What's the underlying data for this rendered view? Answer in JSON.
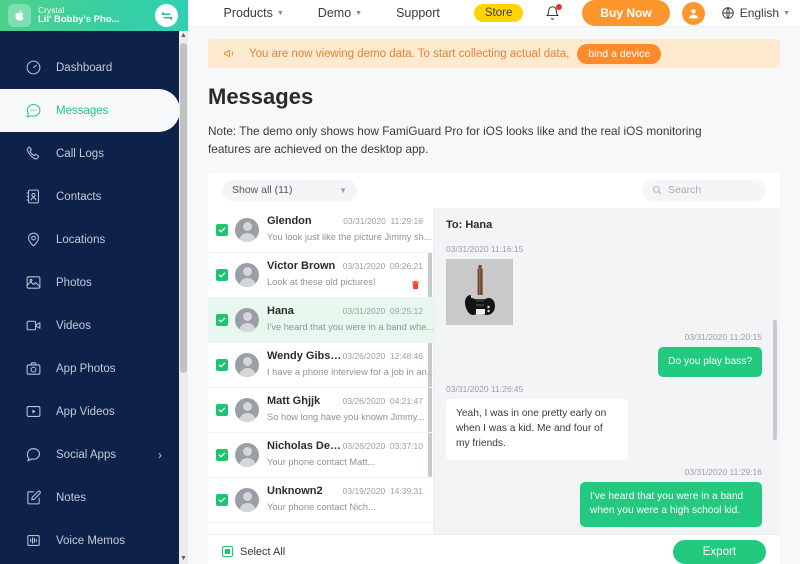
{
  "device": {
    "os_icon": "apple-icon",
    "owner": "Crystal",
    "phone_name": "Lil' Bobby's Pho...",
    "switch_icon": "switch-device-icon"
  },
  "sidebar": {
    "items": [
      {
        "label": "Dashboard",
        "icon": "dashboard-icon",
        "active": false,
        "chevron": false
      },
      {
        "label": "Messages",
        "icon": "messages-icon",
        "active": true,
        "chevron": false
      },
      {
        "label": "Call Logs",
        "icon": "phone-icon",
        "active": false,
        "chevron": false
      },
      {
        "label": "Contacts",
        "icon": "contacts-icon",
        "active": false,
        "chevron": false
      },
      {
        "label": "Locations",
        "icon": "location-pin-icon",
        "active": false,
        "chevron": false
      },
      {
        "label": "Photos",
        "icon": "photo-icon",
        "active": false,
        "chevron": false
      },
      {
        "label": "Videos",
        "icon": "video-icon",
        "active": false,
        "chevron": false
      },
      {
        "label": "App Photos",
        "icon": "camera-icon",
        "active": false,
        "chevron": false
      },
      {
        "label": "App Videos",
        "icon": "play-box-icon",
        "active": false,
        "chevron": false
      },
      {
        "label": "Social Apps",
        "icon": "chat-bubble-icon",
        "active": false,
        "chevron": true
      },
      {
        "label": "Notes",
        "icon": "note-edit-icon",
        "active": false,
        "chevron": false
      },
      {
        "label": "Voice Memos",
        "icon": "waveform-icon",
        "active": false,
        "chevron": false
      }
    ]
  },
  "topnav": {
    "links": [
      {
        "label": "Products",
        "caret": true
      },
      {
        "label": "Demo",
        "caret": true
      },
      {
        "label": "Support",
        "caret": false
      }
    ],
    "store_label": "Store",
    "bell_icon": "notification-bell-icon",
    "buy_now_label": "Buy Now",
    "account_icon": "user-avatar-icon",
    "language_label": "English",
    "language_icon": "globe-icon"
  },
  "banner": {
    "icon": "megaphone-icon",
    "text": "You are now viewing demo data. To start collecting actual data,",
    "button_label": "bind a device"
  },
  "page": {
    "title": "Messages",
    "note": "Note: The demo only shows how FamiGuard Pro for iOS looks like and the real iOS monitoring features are achieved on the desktop app."
  },
  "toolbar": {
    "filter_label": "Show all (11)",
    "filter_caret_icon": "chevron-down-icon",
    "search_icon": "search-icon",
    "search_placeholder": "Search",
    "search_value": ""
  },
  "conversations": [
    {
      "name": "Glendon",
      "date": "03/31/2020",
      "time": "11:29:16",
      "preview": "You look just like the picture Jimmy sh...",
      "checked": true,
      "selected": false,
      "delete": false
    },
    {
      "name": "Victor Brown",
      "date": "03/31/2020",
      "time": "09:26:21",
      "preview": "Look at these old pictures!",
      "checked": true,
      "selected": false,
      "delete": true
    },
    {
      "name": "Hana",
      "date": "03/31/2020",
      "time": "09:25:12",
      "preview": "I've heard that you were in a band whe...",
      "checked": true,
      "selected": true,
      "delete": false
    },
    {
      "name": "Wendy Gibson",
      "date": "03/26/2020",
      "time": "12:48:46",
      "preview": "I have a phone interview for a job in an...",
      "checked": true,
      "selected": false,
      "delete": false
    },
    {
      "name": "Matt Ghjjk",
      "date": "03/26/2020",
      "time": "04:21:47",
      "preview": "So how long have you known Jimmy...",
      "checked": true,
      "selected": false,
      "delete": false
    },
    {
      "name": "Nicholas Dell...",
      "date": "03/26/2020",
      "time": "03:37:10",
      "preview": "Your phone contact Matt...",
      "checked": true,
      "selected": false,
      "delete": false
    },
    {
      "name": "Unknown2",
      "date": "03/19/2020",
      "time": "14:39:31",
      "preview": "Your phone contact Nich...",
      "checked": true,
      "selected": false,
      "delete": false
    }
  ],
  "chat": {
    "to_label": "To: Hana",
    "messages": [
      {
        "direction": "in",
        "timestamp": "03/31/2020  11:16:15",
        "type": "image",
        "text": "",
        "image_icon": "bass-guitar-photo"
      },
      {
        "direction": "out",
        "timestamp": "03/31/2020  11:20:15",
        "type": "text",
        "text": "Do you play bass?"
      },
      {
        "direction": "in",
        "timestamp": "03/31/2020  11:26:45",
        "type": "text",
        "text": "Yeah, I was in one pretty early on when I was a kid. Me and four of my friends."
      },
      {
        "direction": "out",
        "timestamp": "03/31/2020  11:29:16",
        "type": "text",
        "text": "I've heard that you were in a band when you were a high school kid."
      }
    ]
  },
  "footer": {
    "select_all_label": "Select All",
    "export_label": "Export"
  },
  "colors": {
    "sidebar_bg": "#0d2149",
    "accent_green": "#22c97f",
    "accent_orange": "#fd962d",
    "store_yellow": "#ffd400",
    "banner_bg": "#fdeacf"
  }
}
